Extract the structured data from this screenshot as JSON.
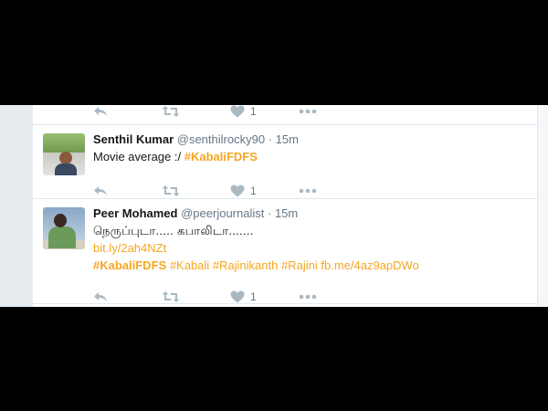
{
  "tweets": [
    {
      "like_count": "1"
    },
    {
      "name": "Senthil Kumar",
      "handle": "@senthilrocky90",
      "separator": "·",
      "time": "15m",
      "text_plain": "Movie average :/ ",
      "hashtag": "#KabaliFDFS",
      "like_count": "1"
    },
    {
      "name": "Peer Mohamed",
      "handle": "@peerjournalist",
      "separator": "·",
      "time": "15m",
      "tamil_text": "நெருப்புடா..... கபாலிடா.......",
      "link": "bit.ly/2ah4NZt",
      "hashtags": [
        "#KabaliFDFS",
        "#Kabali",
        "#Rajinikanth",
        "#Rajini"
      ],
      "link2": "fb.me/4az9apDWo",
      "like_count": "1"
    }
  ],
  "icons": {
    "reply": "reply-icon",
    "retweet": "retweet-icon",
    "like": "heart-icon",
    "more": "more-icon"
  },
  "colors": {
    "hashtag": "#f5a623",
    "muted": "#8899a6",
    "text": "#14171a"
  }
}
